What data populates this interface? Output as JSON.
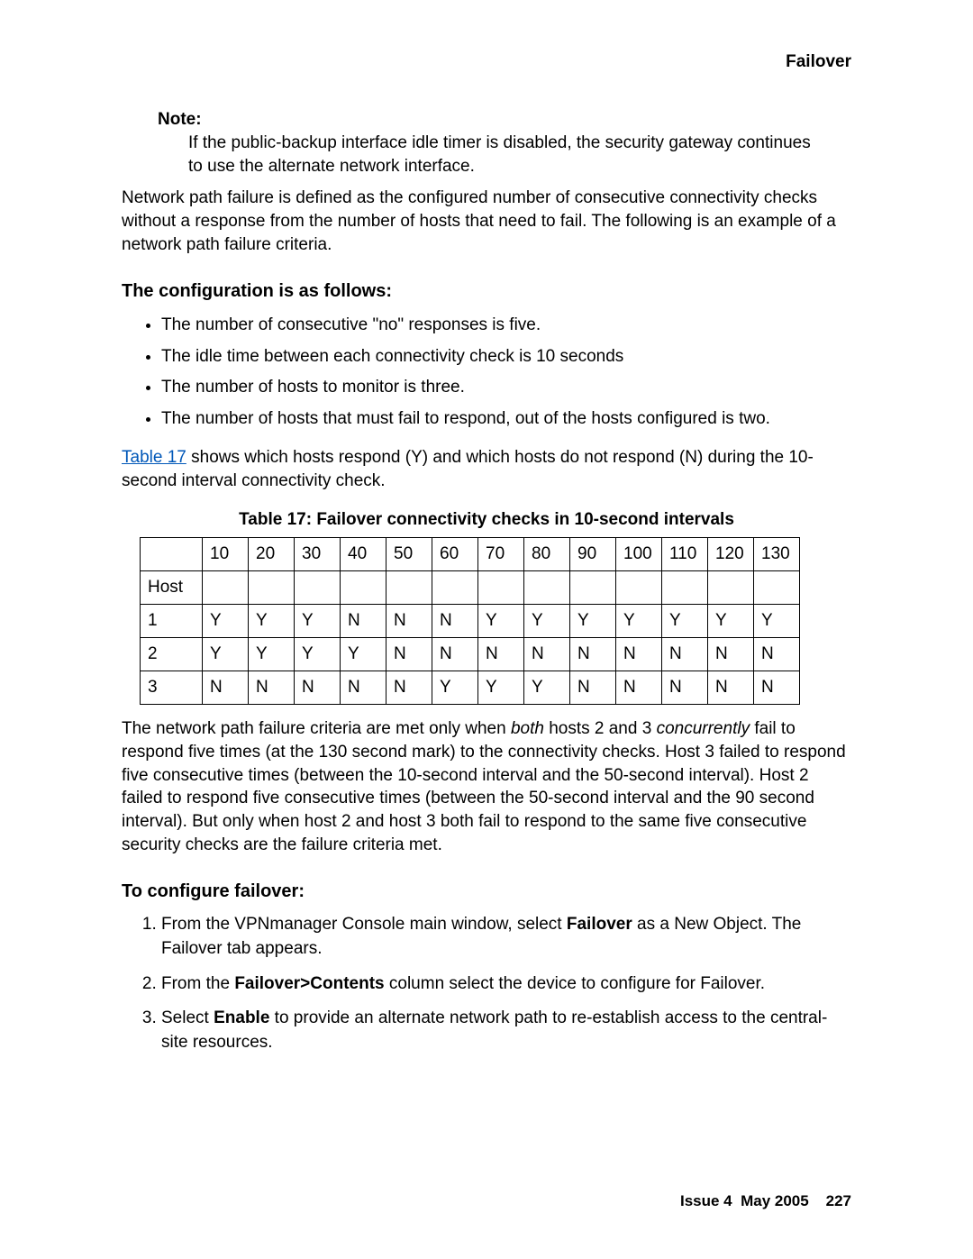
{
  "header": {
    "title": "Failover"
  },
  "note": {
    "label": "Note:",
    "text": "If the public-backup interface idle timer is disabled, the security gateway continues to use the alternate network interface."
  },
  "intro_para": "Network path failure is defined as the configured number of consecutive connectivity checks without a response from the number of hosts that need to fail. The following is an example of a network path failure criteria.",
  "config_heading": "The configuration is as follows:",
  "config_bullets": [
    "The number of consecutive \"no\" responses is five.",
    "The idle time between each connectivity check is 10 seconds",
    "The number of hosts to monitor is three.",
    "The number of hosts that must fail to respond, out of the hosts configured is two."
  ],
  "table_ref_sentence": {
    "link_text": "Table 17",
    "rest": " shows which hosts respond (Y) and which hosts do not respond (N) during the 10-second interval connectivity check."
  },
  "table": {
    "caption": "Table 17: Failover connectivity checks in 10-second intervals",
    "header_row_label": "",
    "columns": [
      "10",
      "20",
      "30",
      "40",
      "50",
      "60",
      "70",
      "80",
      "90",
      "100",
      "110",
      "120",
      "130"
    ],
    "host_label": "Host",
    "rows": [
      {
        "label": "1",
        "cells": [
          "Y",
          "Y",
          "Y",
          "N",
          "N",
          "N",
          "Y",
          "Y",
          "Y",
          "Y",
          "Y",
          "Y",
          "Y"
        ]
      },
      {
        "label": "2",
        "cells": [
          "Y",
          "Y",
          "Y",
          "Y",
          "N",
          "N",
          "N",
          "N",
          "N",
          "N",
          "N",
          "N",
          "N"
        ]
      },
      {
        "label": "3",
        "cells": [
          "N",
          "N",
          "N",
          "N",
          "N",
          "Y",
          "Y",
          "Y",
          "N",
          "N",
          "N",
          "N",
          "N"
        ]
      }
    ]
  },
  "after_table_para_parts": [
    "The network path failure criteria are met only when ",
    "both",
    " hosts 2 and 3 ",
    "concurrently",
    " fail to respond five times (at the 130 second mark) to the connectivity checks. Host 3 failed to respond five consecutive times (between the 10-second interval and the 50-second interval). Host 2 failed to respond five consecutive times (between the 50-second interval and the 90 second interval). But only when host 2 and host 3 both fail to respond to the same five consecutive security checks are the failure criteria met."
  ],
  "configure_heading": "To configure failover:",
  "configure_steps": [
    {
      "pre": "From the VPNmanager Console main window, select ",
      "bold1": "Failover",
      "post1": " as a New Object. The Failover tab appears."
    },
    {
      "pre": "From the ",
      "bold1": "Failover>Contents",
      "post1": " column select the device to configure for Failover."
    },
    {
      "pre": "Select ",
      "bold1": "Enable",
      "post1": " to provide an alternate network path to re-establish access to the central-site resources."
    }
  ],
  "footer": {
    "issue": "Issue 4",
    "date": "May 2005",
    "page": "227"
  }
}
